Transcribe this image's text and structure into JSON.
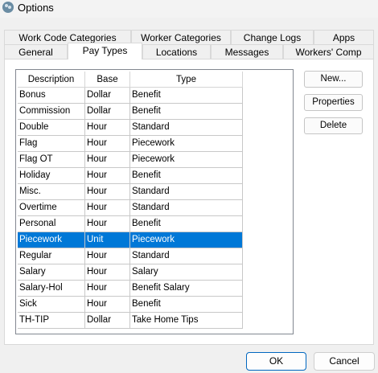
{
  "window": {
    "title": "Options"
  },
  "tabs": {
    "back_row": [
      "Work Code Categories",
      "Worker Categories",
      "Change Logs",
      "Apps"
    ],
    "front_row": [
      "General",
      "Pay Types",
      "Locations",
      "Messages",
      "Workers' Comp"
    ],
    "active": "Pay Types"
  },
  "table": {
    "columns": [
      "Description",
      "Base",
      "Type"
    ],
    "rows": [
      [
        "Bonus",
        "Dollar",
        "Benefit"
      ],
      [
        "Commission",
        "Dollar",
        "Benefit"
      ],
      [
        "Double",
        "Hour",
        "Standard"
      ],
      [
        "Flag",
        "Hour",
        "Piecework"
      ],
      [
        "Flag OT",
        "Hour",
        "Piecework"
      ],
      [
        "Holiday",
        "Hour",
        "Benefit"
      ],
      [
        "Misc.",
        "Hour",
        "Standard"
      ],
      [
        "Overtime",
        "Hour",
        "Standard"
      ],
      [
        "Personal",
        "Hour",
        "Benefit"
      ],
      [
        "Piecework",
        "Unit",
        "Piecework"
      ],
      [
        "Regular",
        "Hour",
        "Standard"
      ],
      [
        "Salary",
        "Hour",
        "Salary"
      ],
      [
        "Salary-Hol",
        "Hour",
        "Benefit Salary"
      ],
      [
        "Sick",
        "Hour",
        "Benefit"
      ],
      [
        "TH-TIP",
        "Dollar",
        "Take Home Tips"
      ]
    ],
    "selected_row": "Piecework"
  },
  "side_buttons": {
    "new": "New...",
    "properties": "Properties",
    "delete": "Delete"
  },
  "footer": {
    "ok": "OK",
    "cancel": "Cancel"
  },
  "colors": {
    "selection": "#0078d7",
    "default_button_border": "#0067c0"
  }
}
